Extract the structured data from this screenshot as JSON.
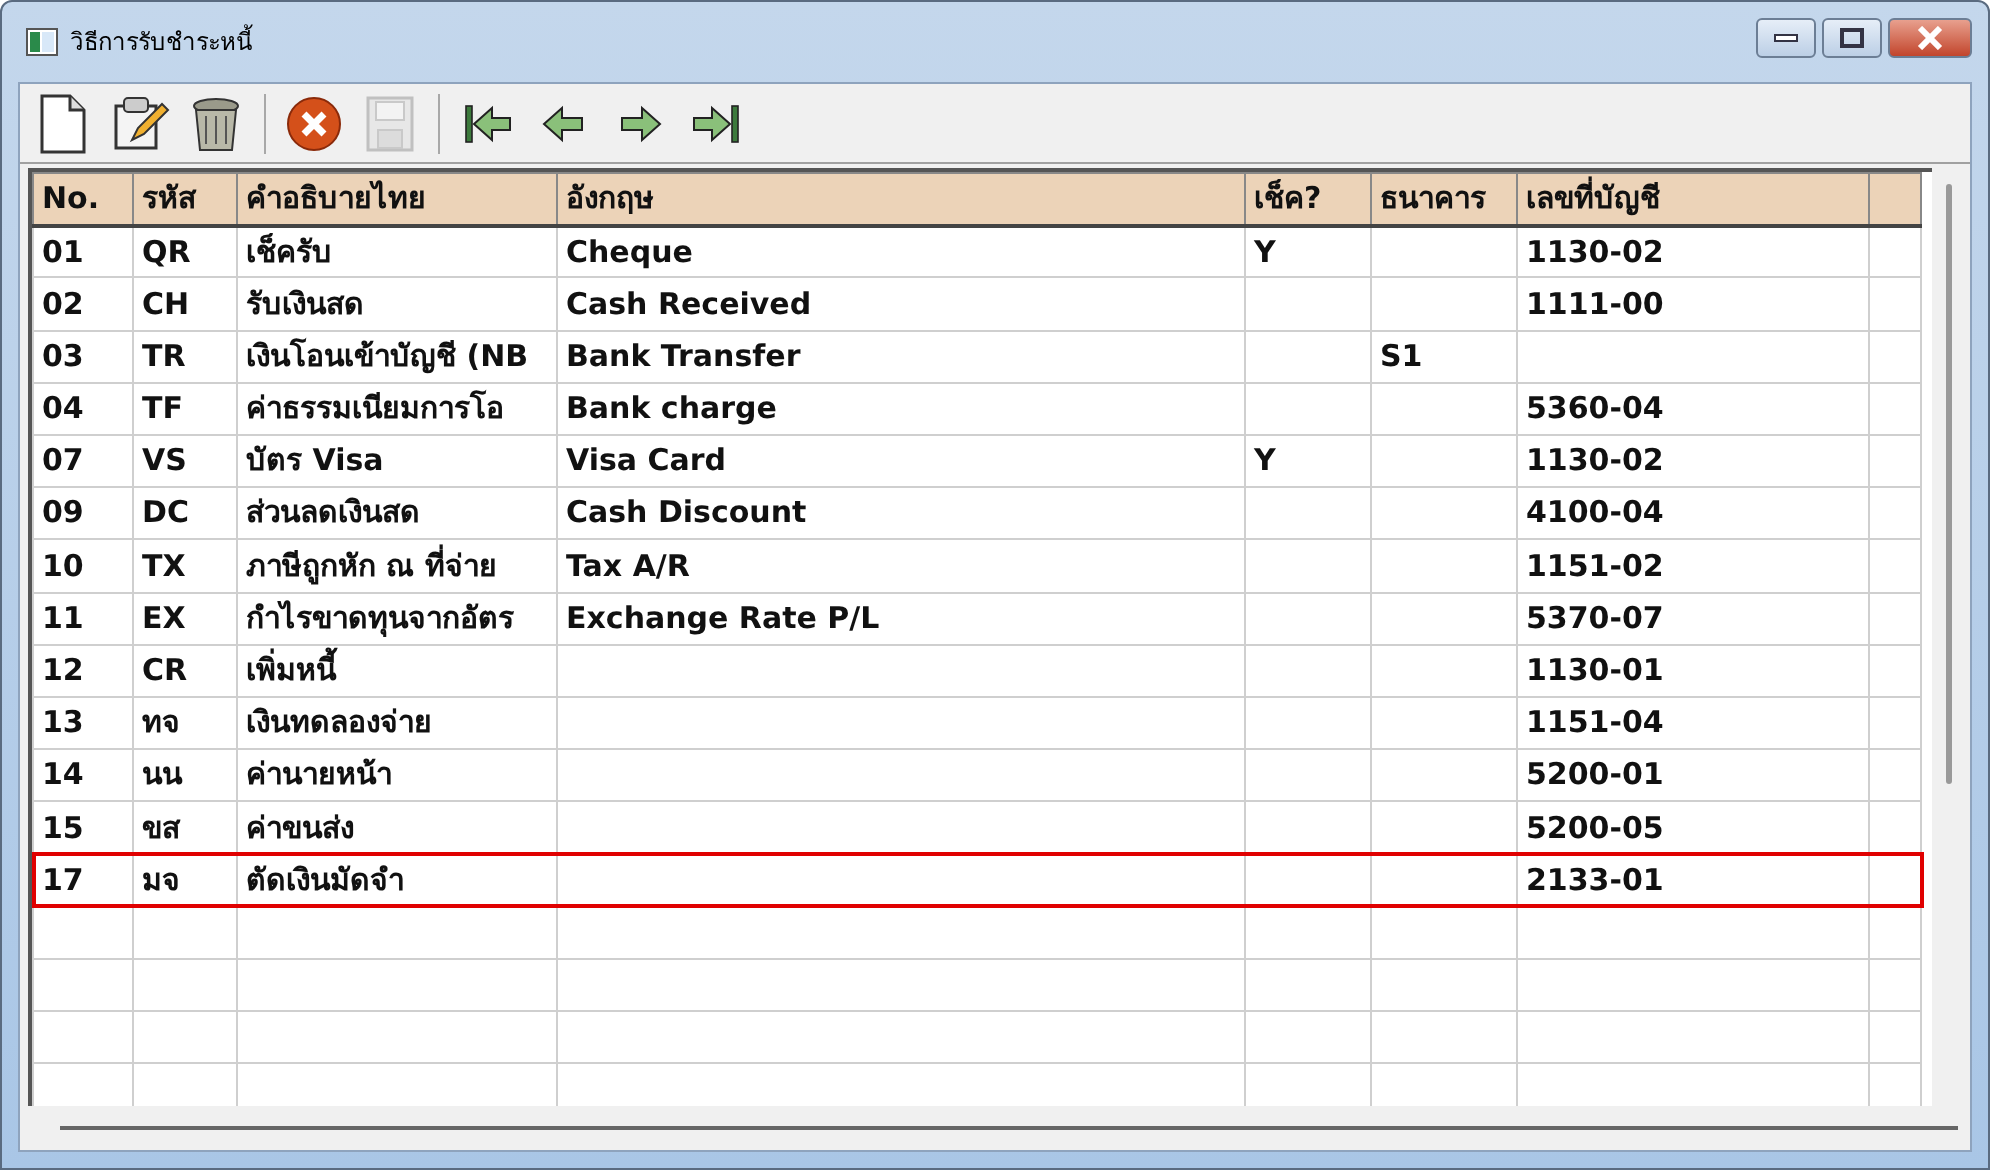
{
  "window": {
    "title": "วิธีการรับชำระหนี้"
  },
  "toolbar": [
    {
      "kind": "new",
      "disabled": false
    },
    {
      "kind": "edit",
      "disabled": false
    },
    {
      "kind": "delete",
      "disabled": false
    },
    {
      "kind": "separator"
    },
    {
      "kind": "cancel",
      "disabled": false
    },
    {
      "kind": "save",
      "disabled": true
    },
    {
      "kind": "separator"
    },
    {
      "kind": "first",
      "disabled": false
    },
    {
      "kind": "prev",
      "disabled": false
    },
    {
      "kind": "next",
      "disabled": false
    },
    {
      "kind": "last",
      "disabled": false
    }
  ],
  "table": {
    "columns": [
      "No.",
      "รหัส",
      "คำอธิบายไทย",
      "อังกฤษ",
      "เช็ค?",
      "ธนาคาร",
      "เลขที่บัญชี"
    ],
    "rows": [
      {
        "cells": [
          "01",
          "QR",
          "เช็ครับ",
          "Cheque",
          "Y",
          "",
          "1130-02"
        ],
        "selected": false
      },
      {
        "cells": [
          "02",
          "CH",
          "รับเงินสด",
          "Cash Received",
          "",
          "",
          "1111-00"
        ],
        "selected": false
      },
      {
        "cells": [
          "03",
          "TR",
          "เงินโอนเข้าบัญชี (NB",
          "Bank Transfer",
          "",
          "S1",
          ""
        ],
        "selected": false
      },
      {
        "cells": [
          "04",
          "TF",
          "ค่าธรรมเนียมการโอ",
          "Bank charge",
          "",
          "",
          "5360-04"
        ],
        "selected": false
      },
      {
        "cells": [
          "07",
          "VS",
          "บัตร Visa",
          "Visa Card",
          "Y",
          "",
          "1130-02"
        ],
        "selected": false
      },
      {
        "cells": [
          "09",
          "DC",
          "ส่วนลดเงินสด",
          "Cash Discount",
          "",
          "",
          "4100-04"
        ],
        "selected": false
      },
      {
        "cells": [
          "10",
          "TX",
          "ภาษีถูกหัก ณ ที่จ่าย",
          "Tax A/R",
          "",
          "",
          "1151-02"
        ],
        "selected": false
      },
      {
        "cells": [
          "11",
          "EX",
          "กำไรขาดทุนจากอัตร",
          "Exchange Rate P/L",
          "",
          "",
          "5370-07"
        ],
        "selected": false
      },
      {
        "cells": [
          "12",
          "CR",
          "เพิ่มหนี้",
          "",
          "",
          "",
          "1130-01"
        ],
        "selected": false
      },
      {
        "cells": [
          "13",
          "ทจ",
          "เงินทดลองจ่าย",
          "",
          "",
          "",
          "1151-04"
        ],
        "selected": false
      },
      {
        "cells": [
          "14",
          "นน",
          "ค่านายหน้า",
          "",
          "",
          "",
          "5200-01"
        ],
        "selected": false
      },
      {
        "cells": [
          "15",
          "ขส",
          "ค่าขนส่ง",
          "",
          "",
          "",
          "5200-05"
        ],
        "selected": false
      },
      {
        "cells": [
          "17",
          "มจ",
          "ตัดเงินมัดจำ",
          "",
          "",
          "",
          "2133-01"
        ],
        "selected": true
      }
    ]
  }
}
